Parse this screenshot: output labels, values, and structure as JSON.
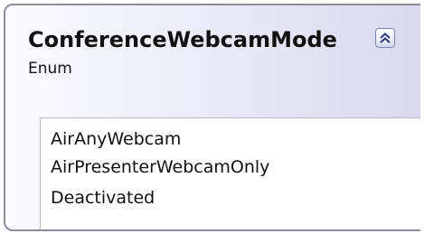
{
  "type_shape": {
    "name": "ConferenceWebcamMode",
    "kind": "Enum",
    "collapse_icon": "double-chevron-up-icon",
    "members": [
      "AirAnyWebcam",
      "AirPresenterWebcamOnly",
      "Deactivated"
    ]
  }
}
